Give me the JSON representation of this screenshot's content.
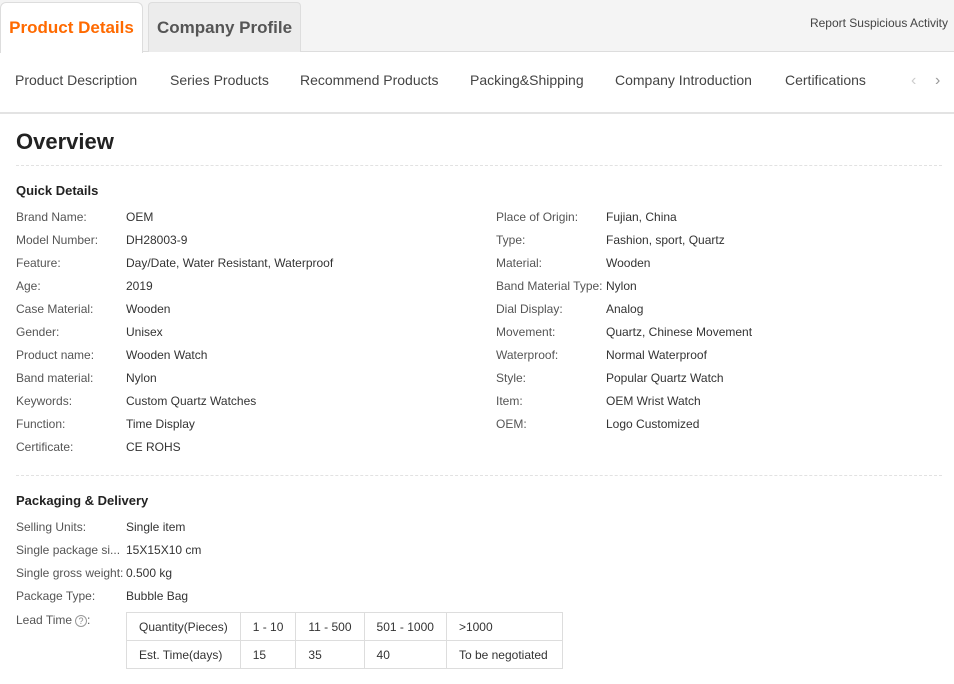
{
  "tabs": {
    "active": "Product Details",
    "inactive": "Company Profile",
    "report": "Report Suspicious Activity"
  },
  "subnav": [
    "Product Description",
    "Series Products",
    "Recommend Products",
    "Packing&Shipping",
    "Company Introduction",
    "Certifications"
  ],
  "overview": {
    "title": "Overview",
    "quick_details_title": "Quick Details",
    "left": [
      {
        "label": "Brand Name:",
        "value": "OEM"
      },
      {
        "label": "Model Number:",
        "value": "DH28003-9"
      },
      {
        "label": "Feature:",
        "value": "Day/Date, Water Resistant, Waterproof"
      },
      {
        "label": "Age:",
        "value": "2019"
      },
      {
        "label": "Case Material:",
        "value": "Wooden"
      },
      {
        "label": "Gender:",
        "value": "Unisex"
      },
      {
        "label": "Product name:",
        "value": "Wooden Watch"
      },
      {
        "label": "Band material:",
        "value": "Nylon"
      },
      {
        "label": "Keywords:",
        "value": "Custom Quartz Watches"
      },
      {
        "label": "Function:",
        "value": "Time Display"
      },
      {
        "label": "Certificate:",
        "value": "CE ROHS"
      }
    ],
    "right": [
      {
        "label": "Place of Origin:",
        "value": "Fujian, China"
      },
      {
        "label": "Type:",
        "value": "Fashion, sport, Quartz"
      },
      {
        "label": "Material:",
        "value": "Wooden"
      },
      {
        "label": "Band Material Type:",
        "value": "Nylon"
      },
      {
        "label": "Dial Display:",
        "value": "Analog"
      },
      {
        "label": "Movement:",
        "value": "Quartz, Chinese Movement"
      },
      {
        "label": "Waterproof:",
        "value": "Normal Waterproof"
      },
      {
        "label": "Style:",
        "value": "Popular Quartz Watch"
      },
      {
        "label": "Item:",
        "value": "OEM Wrist Watch"
      },
      {
        "label": "OEM:",
        "value": "Logo Customized"
      }
    ]
  },
  "packaging": {
    "title": "Packaging & Delivery",
    "rows": [
      {
        "label": "Selling Units:",
        "value": "Single item"
      },
      {
        "label": "Single package si...",
        "value": "15X15X10 cm"
      },
      {
        "label": "Single gross weight:",
        "value": "0.500 kg"
      },
      {
        "label": "Package Type:",
        "value": "Bubble Bag"
      }
    ],
    "lead_time_label": "Lead Time",
    "lead_table": {
      "header": [
        "Quantity(Pieces)",
        "1 - 10",
        "11 - 500",
        "501 - 1000",
        ">1000"
      ],
      "row": [
        "Est. Time(days)",
        "15",
        "35",
        "40",
        "To be negotiated"
      ]
    }
  },
  "icons": {
    "prev": "chevron-left-icon",
    "next": "chevron-right-icon",
    "help": "question-circle-icon"
  },
  "colors": {
    "accent": "#ff6a00"
  }
}
